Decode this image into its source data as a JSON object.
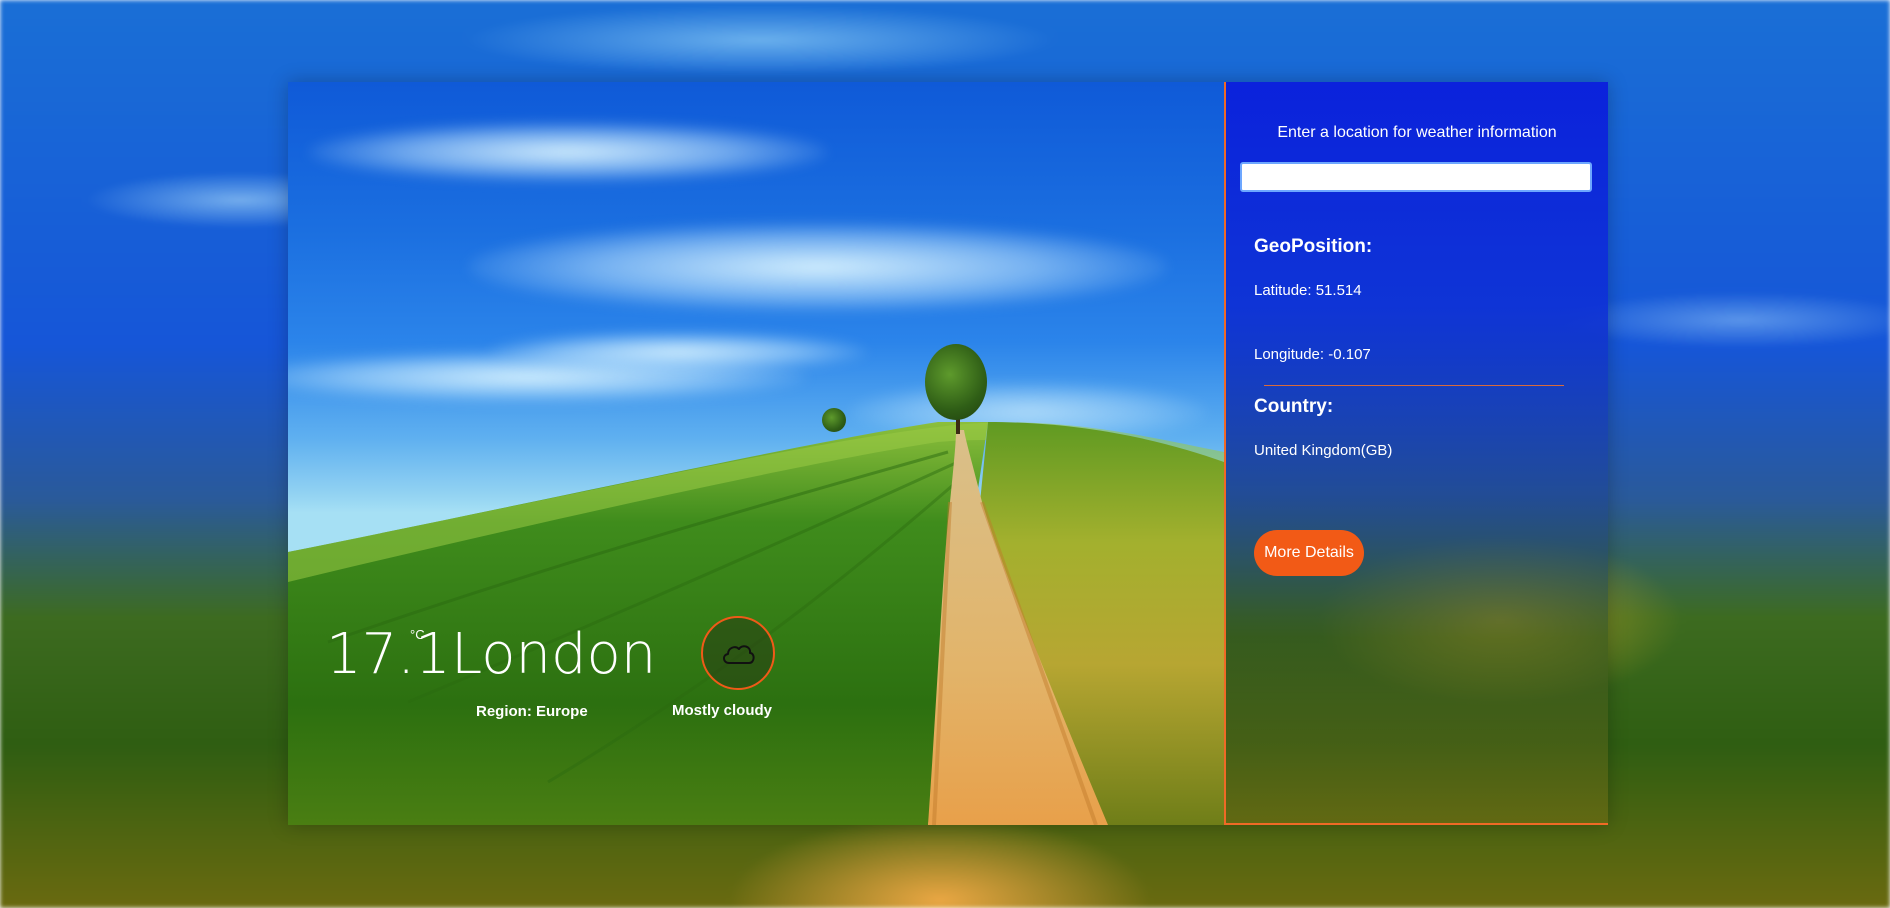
{
  "weather": {
    "temperature": "17.1",
    "unit": "°C",
    "city": "London",
    "region_text": "Region: Europe",
    "condition": "Mostly cloudy",
    "condition_icon": "cloud-icon"
  },
  "sidebar": {
    "prompt": "Enter a location for weather information",
    "search_value": "",
    "search_placeholder": "",
    "geoposition_title": "GeoPosition:",
    "latitude_text": "Latitude: 51.514",
    "longitude_text": "Longitude: -0.107",
    "country_title": "Country:",
    "country_value": "United Kingdom(GB)",
    "more_details_label": "More Details"
  },
  "colors": {
    "accent": "#f25a16",
    "sidebar_blue": "#0a1edc",
    "input_border": "#6da7ff"
  }
}
